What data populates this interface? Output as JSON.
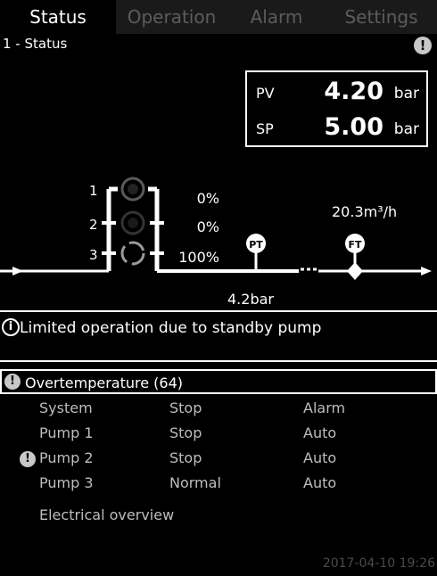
{
  "tabs": [
    {
      "label": "Status"
    },
    {
      "label": "Operation"
    },
    {
      "label": "Alarm"
    },
    {
      "label": "Settings"
    }
  ],
  "screen_title": "1 - Status",
  "warning_glyph": "!",
  "pv": {
    "label": "PV",
    "value": "4.20",
    "unit": "bar"
  },
  "sp": {
    "label": "SP",
    "value": "5.00",
    "unit": "bar"
  },
  "pumps": [
    {
      "number": "1",
      "speed": "0%"
    },
    {
      "number": "2",
      "speed": "0%"
    },
    {
      "number": "3",
      "speed": "100%"
    }
  ],
  "sensors": {
    "pressure_tag": "PT",
    "flow_tag": "FT"
  },
  "flow_value": "20.3m³/h",
  "pressure_value": "4.2bar",
  "info_icon_glyph": "i",
  "info_message": "Limited operation due to standby pump",
  "alarm_message": "Overtemperature (64)",
  "status_rows": [
    {
      "name": "System",
      "state": "Stop",
      "mode": "Alarm",
      "warning": false
    },
    {
      "name": "Pump 1",
      "state": "Stop",
      "mode": "Auto",
      "warning": false
    },
    {
      "name": "Pump 2",
      "state": "Stop",
      "mode": "Auto",
      "warning": true
    },
    {
      "name": "Pump 3",
      "state": "Normal",
      "mode": "Auto",
      "warning": false
    }
  ],
  "electrical_overview": "Electrical overview",
  "timestamp": "2017-04-10 19:26",
  "colors": {
    "background": "#000000",
    "foreground": "#ffffff",
    "tab_inactive": "#5c5c5c",
    "row_text": "#bdbdbd",
    "warning_badge": "#c8c8c8"
  },
  "icons": [
    "warning-icon",
    "info-icon",
    "pump-icon",
    "pressure-transmitter-icon",
    "flow-transmitter-icon"
  ]
}
